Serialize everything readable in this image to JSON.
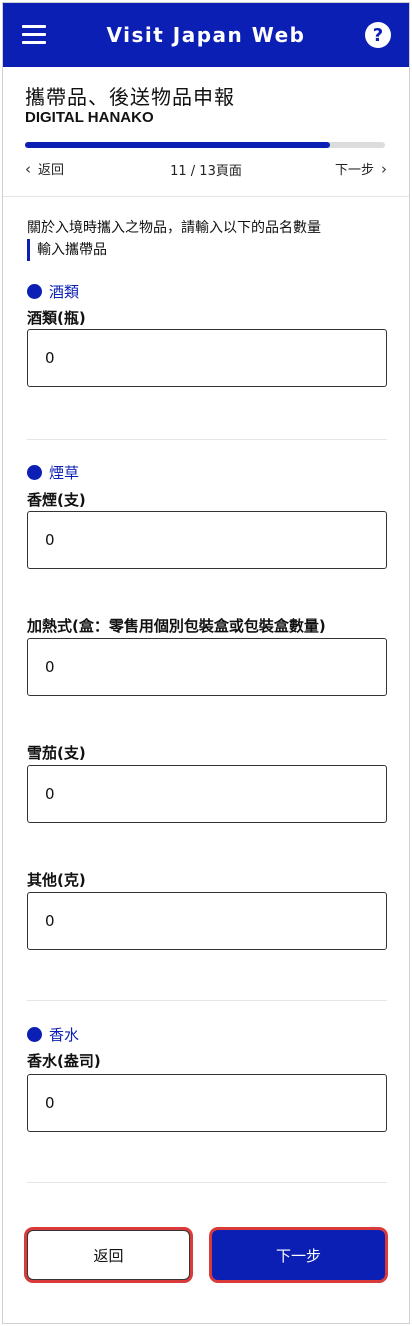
{
  "header": {
    "title": "Visit Japan Web",
    "menu_icon": "menu-icon",
    "help_label": "?"
  },
  "page": {
    "heading": "攜帶品、後送物品申報",
    "user_name": "DIGITAL HANAKO"
  },
  "progress": {
    "current_page": 11,
    "total_pages": 13,
    "fraction": 0.846
  },
  "nav": {
    "back_label": "返回",
    "page_indicator": "11 / 13頁面",
    "next_label": "下一步"
  },
  "form": {
    "instruction": "關於入境時攜入之物品，請輸入以下的品名數量",
    "subheading": "輸入攜帶品",
    "sections": {
      "alcohol": {
        "title": "酒類",
        "fields": {
          "bottles": {
            "label": "酒類(瓶)",
            "value": "0"
          }
        }
      },
      "tobacco": {
        "title": "煙草",
        "fields": {
          "cigarettes": {
            "label": "香煙(支)",
            "value": "0"
          },
          "heated": {
            "label": "加熱式(盒：零售用個別包裝盒或包裝盒數量)",
            "value": "0"
          },
          "cigars": {
            "label": "雪茄(支)",
            "value": "0"
          },
          "other": {
            "label": "其他(克)",
            "value": "0"
          }
        }
      },
      "perfume": {
        "title": "香水",
        "fields": {
          "ounces": {
            "label": "香水(盎司)",
            "value": "0"
          }
        }
      }
    }
  },
  "footer": {
    "back_button": "返回",
    "next_button": "下一步"
  },
  "colors": {
    "brand": "#0b1fb4",
    "highlight": "#d93a3a"
  }
}
